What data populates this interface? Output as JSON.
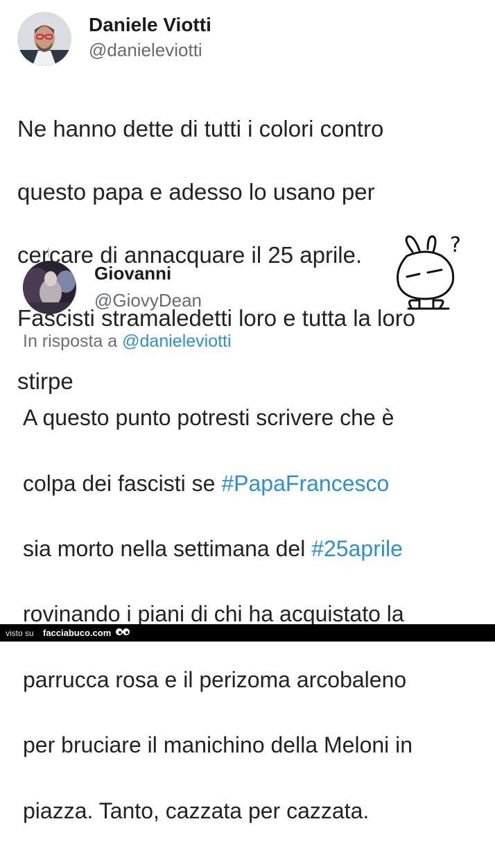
{
  "original_tweet": {
    "author_name": "Daniele Viotti",
    "author_handle": "@danieleviotti",
    "text_lines": [
      "Ne hanno dette di tutti i colori contro",
      "questo papa e adesso lo usano per",
      "cercare di annacquare il 25 aprile.",
      "Fascisti stramaledetti loro e tutta la loro",
      "stirpe"
    ]
  },
  "reply_tweet": {
    "author_name": "Giovanni",
    "author_handle": "@GiovyDean",
    "reply_prefix": "In risposta a ",
    "reply_to": "@danieleviotti",
    "text": {
      "l1": "A questo punto potresti scrivere che è",
      "l2_pre": "colpa dei fascisti se ",
      "l2_tag": "#PapaFrancesco",
      "l3_pre": "sia morto nella settimana del ",
      "l3_tag": "#25aprile",
      "l4": "rovinando i piani di chi ha acquistato la",
      "l5": "parrucca rosa e il perizoma arcobaleno",
      "l6": "per bruciare il manichino della Meloni in",
      "l7": "piazza. Tanto, cazzata per cazzata."
    }
  },
  "sticker": {
    "question_mark": "?"
  },
  "footer": {
    "seen_on": "visto su",
    "site": "facciabuco.com"
  },
  "colors": {
    "link": "#2a8fd8",
    "handle": "#666b70",
    "footer_bg": "#000000"
  }
}
